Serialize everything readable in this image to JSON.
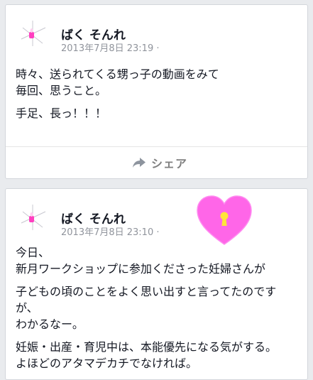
{
  "posts": [
    {
      "author": "ばく そんれ",
      "timestamp": "2013年7月8日 23:19 ·",
      "paragraphs": [
        "時々、送られてくる甥っ子の動画をみて\n毎回、思うこと。",
        "手足、長っ！！！"
      ],
      "share_label": "シェア"
    },
    {
      "author": "ばく そんれ",
      "timestamp": "2013年7月8日 23:10 ·",
      "paragraphs": [
        "今日、\n新月ワークショップに参加くださった妊婦さんが",
        "子どもの頃のことをよく思い出すと言ってたのです\nが、\nわかるなー。",
        "妊娠・出産・育児中は、本能優先になる気がする。\nよほどのアタマデカチでなければ。"
      ]
    }
  ],
  "icons": {
    "share": "share-arrow-icon",
    "avatar": "candle-avatar-icon",
    "sticker": "heart-keyhole-sticker"
  },
  "colors": {
    "background": "#e9ebee",
    "heart": "#ff66e8",
    "keyhole": "#ffe53a",
    "avatar_flame": "#ff3fc0"
  }
}
